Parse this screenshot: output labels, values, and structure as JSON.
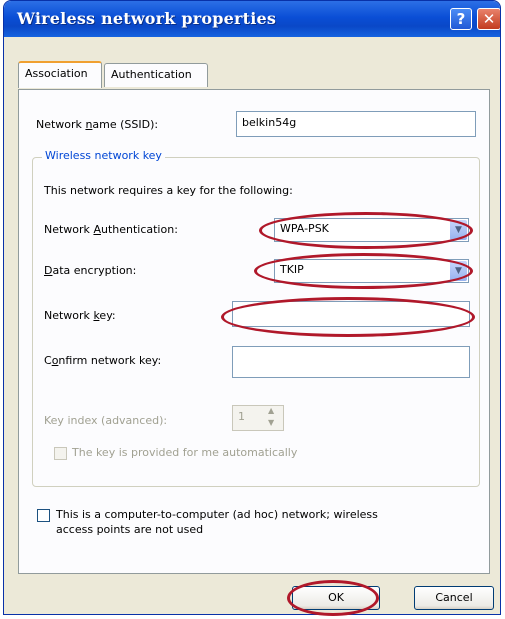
{
  "window": {
    "title": "Wireless network properties",
    "help_icon": "?",
    "close_icon": "✕"
  },
  "tabs": [
    {
      "label": "Association",
      "active": true
    },
    {
      "label": "Authentication",
      "active": false
    }
  ],
  "association": {
    "ssid_label": "Network name (SSID):",
    "ssid_value": "belkin54g",
    "group_label": "Wireless network key",
    "key_required_text": "This network requires a key for the following:",
    "auth_label": "Network Authentication:",
    "auth_value": "WPA-PSK",
    "encryption_label": "Data encryption:",
    "encryption_value": "TKIP",
    "network_key_label": "Network key:",
    "network_key_value": "",
    "confirm_key_label": "Confirm network key:",
    "confirm_key_value": "",
    "key_index_label": "Key index (advanced):",
    "key_index_value": "1",
    "auto_key_label": "The key is provided for me automatically",
    "auto_key_checked": false,
    "adhoc_label_line1": "This is a computer-to-computer (ad hoc) network; wireless",
    "adhoc_label_line2": "access points are not used",
    "adhoc_checked": false
  },
  "buttons": {
    "ok": "OK",
    "cancel": "Cancel"
  },
  "colors": {
    "title_bar": "#0a4ed6",
    "highlight_ovals": "#b0182a"
  }
}
